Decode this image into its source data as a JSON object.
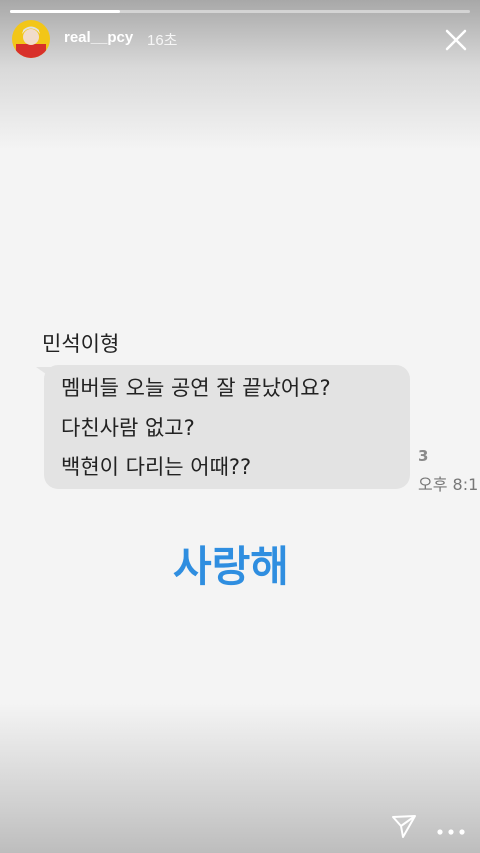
{
  "story": {
    "progress": 0.24,
    "username": "real__pcy",
    "timestamp": "16초"
  },
  "message": {
    "sender": "민석이형",
    "lines": [
      "멤버들 오늘 공연 잘 끝났어요?",
      "다친사람 없고?",
      "백현이 다리는 어때??"
    ],
    "read_count": "3",
    "time": "오후 8:1"
  },
  "overlay": {
    "text": "사랑해",
    "color": "#2f8ee0"
  },
  "icons": {
    "close": "close-icon",
    "send": "paper-plane-icon",
    "more": "more-icon"
  }
}
